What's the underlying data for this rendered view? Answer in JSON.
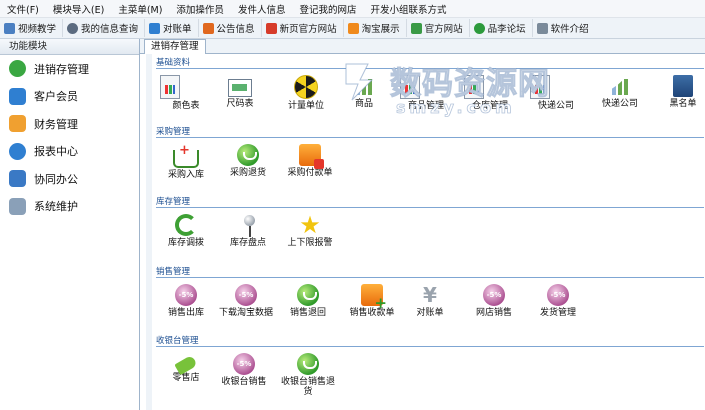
{
  "menubar": {
    "items": [
      "文件(F)",
      "模块导入(E)",
      "主菜单(M)",
      "添加操作员",
      "发件人信息",
      "登记我的网店",
      "开发小组联系方式"
    ]
  },
  "toolbar": {
    "items": [
      {
        "label": "视频教学",
        "icon": "video-icon",
        "color": "#4a7fc1"
      },
      {
        "label": "我的信息查询",
        "icon": "user-icon",
        "color": "#5b6b80"
      },
      {
        "label": "对账单",
        "icon": "tag-icon",
        "color": "#2f7fd1"
      },
      {
        "label": "公告信息",
        "icon": "megaphone-icon",
        "color": "#e0681f"
      },
      {
        "label": "新页官方网站",
        "icon": "site-icon",
        "color": "#d63b2a"
      },
      {
        "label": "淘宝展示",
        "icon": "cart-icon",
        "color": "#f08a1c"
      },
      {
        "label": "官方网站",
        "icon": "home-icon",
        "color": "#3a9a46"
      },
      {
        "label": "品李论坛",
        "icon": "forum-icon",
        "color": "#2c9a3c"
      },
      {
        "label": "软件介绍",
        "icon": "info-icon",
        "color": "#7a8a9a"
      }
    ]
  },
  "sidebar": {
    "header": "功能模块",
    "items": [
      {
        "label": "进销存管理",
        "icon": "check-icon",
        "color": "#3aa742"
      },
      {
        "label": "客户会员",
        "icon": "member-icon",
        "color": "#2f7fd1"
      },
      {
        "label": "财务管理",
        "icon": "folder-icon",
        "color": "#f0a030"
      },
      {
        "label": "报表中心",
        "icon": "report-icon",
        "color": "#2f7fd1"
      },
      {
        "label": "协同办公",
        "icon": "calendar-icon",
        "color": "#3a79c5"
      },
      {
        "label": "系统维护",
        "icon": "lock-icon",
        "color": "#8aa0b8"
      }
    ]
  },
  "tab": {
    "label": "进销存管理"
  },
  "sections": [
    {
      "title": "基础资料",
      "items": [
        {
          "label": "颜色表",
          "icon": "color-table-icon"
        },
        {
          "label": "尺码表",
          "icon": "size-table-icon"
        },
        {
          "label": "计量单位",
          "icon": "unit-icon"
        },
        {
          "label": "商品",
          "icon": "product-icon"
        },
        {
          "label": "商品管理",
          "icon": "product-manage-icon"
        },
        {
          "label": "仓库管理",
          "icon": "warehouse-icon"
        },
        {
          "label": "快递公司",
          "icon": "express-icon"
        },
        {
          "label": "快递公司",
          "icon": "courier-icon"
        },
        {
          "label": "黑名单",
          "icon": "blacklist-icon"
        }
      ]
    },
    {
      "title": "采购管理",
      "items": [
        {
          "label": "采购入库",
          "icon": "purchase-in-icon"
        },
        {
          "label": "采购退货",
          "icon": "purchase-return-icon"
        },
        {
          "label": "采购付款单",
          "icon": "payment-icon"
        }
      ]
    },
    {
      "title": "库存管理",
      "items": [
        {
          "label": "库存调拨",
          "icon": "transfer-icon"
        },
        {
          "label": "库存盘点",
          "icon": "stocktake-icon"
        },
        {
          "label": "上下限报警",
          "icon": "alarm-star-icon"
        }
      ]
    },
    {
      "title": "销售管理",
      "items": [
        {
          "label": "销售出库",
          "icon": "sale-out-icon"
        },
        {
          "label": "下载淘宝数据",
          "icon": "download-icon"
        },
        {
          "label": "销售退回",
          "icon": "sale-return-icon"
        },
        {
          "label": "销售收款单",
          "icon": "receipt-icon"
        },
        {
          "label": "对账单",
          "icon": "yen-icon"
        },
        {
          "label": "网店销售",
          "icon": "shop-sale-icon"
        },
        {
          "label": "发货管理",
          "icon": "shipping-icon"
        }
      ]
    },
    {
      "title": "收银台管理",
      "items": [
        {
          "label": "零售店",
          "icon": "retail-tag-icon"
        },
        {
          "label": "收银台销售",
          "icon": "cashier-sale-icon"
        },
        {
          "label": "收银台销售退货",
          "icon": "cashier-return-icon"
        }
      ]
    }
  ],
  "badge_text": "-5%",
  "watermark": {
    "text": "数码资源网",
    "sub": "smzy.com"
  }
}
